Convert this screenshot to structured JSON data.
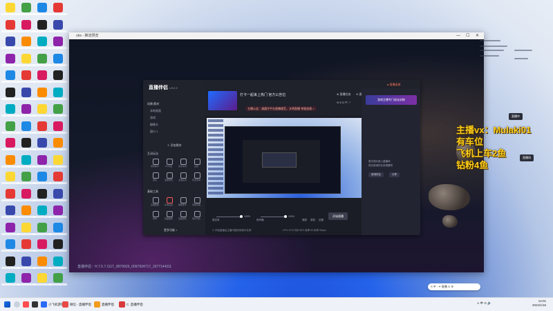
{
  "outer_window": {
    "title": "obs - 推流预览",
    "min": "—",
    "max": "☐",
    "close": "✕",
    "bottom_text": "直播伴侣：H.7.5.7.111T_8979925_0097924717_1977144311"
  },
  "app": {
    "logo": "直播伴侣",
    "version": "v.9.2.2",
    "scenes_header": "场景/素材",
    "scene_items": [
      "本地画面",
      "游戏",
      "摄像头",
      "窗口 1"
    ],
    "add_scene": "＋ 添加素材",
    "live_tools_header": "互动玩法",
    "live_tools": [
      "游戏助手",
      "PK对战",
      "麦序房间",
      "设置",
      "连麦",
      "直播预告",
      "主播任务",
      "玩法商城"
    ],
    "basic_tools_header": "基础工具",
    "basic_tools": [
      "直播数据",
      "礼物设置",
      "弹幕助手",
      "场控管理",
      "特效",
      "直播画质",
      "直播通知",
      "观众列表"
    ],
    "more_tools": "更多功能 >",
    "live_title": "打卡一起来上热门    官方公告位",
    "notice": "主播公告：请遵守平台直播规范，文明直播    举报违规 >",
    "top_right": [
      "⊕ 直播任务",
      "⊖ 直播管理",
      "⊙ 开播"
    ],
    "record_btn": "● 直播录屏",
    "top_icons": "⊖ 5 ☐ ⇱ ♡",
    "gift_banner": "游戏主播专门成长训练",
    "right_empty": "暂无观众进入直播间",
    "right_sub": "快去邀请好友来观看吧",
    "right_btns": [
      "邀请好友",
      "分享",
      "更多设置",
      "开播"
    ],
    "mic_label": "麦克风",
    "mic_value": "100%",
    "speaker_label": "扬声器",
    "speaker_value": "100%",
    "ctrl_labels": [
      "美颜",
      "录制",
      "设置"
    ],
    "start_btn": "开始直播",
    "status_line": "⊙ 开始直播后主播可能收到观众礼物",
    "stats": "CPU 12%  内存 36%  帧率 60  码率 0kbps"
  },
  "overlay_lines": [
    "主播vx：Mulaki01",
    "有车位",
    "飞机上车2鱼",
    "钻粉4鱼"
  ],
  "desktop_right": {
    "btn1": "直播中",
    "btn2": "直播间"
  },
  "taskbar": {
    "search": "搜索",
    "items": [
      "小飞机游戏",
      "微信 - 直播伴侣",
      "直播伴侣",
      "C. 直播伴侣"
    ],
    "tray": "∧ 中 ⊙ 🔊",
    "time": "14:01",
    "date": "2024/1/16"
  },
  "floater": "S 中 · ✦ 直播 ⊙ ⚙",
  "colors": {
    "overlay_text": "#ffcf1a",
    "accent_red": "#ff7a59",
    "app_bg": "#1b1d26"
  }
}
